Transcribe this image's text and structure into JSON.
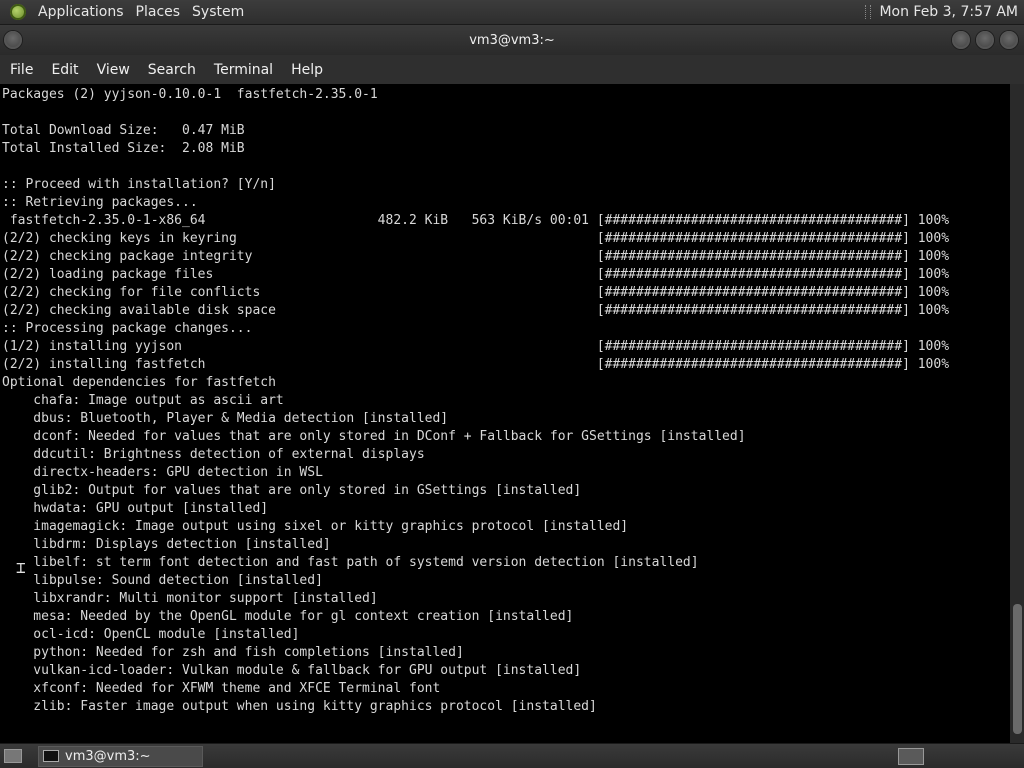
{
  "top_panel": {
    "menus": [
      "Applications",
      "Places",
      "System"
    ],
    "clock": "Mon Feb  3,  7:57 AM"
  },
  "window": {
    "title": "vm3@vm3:~"
  },
  "menubar": {
    "items": [
      "File",
      "Edit",
      "View",
      "Search",
      "Terminal",
      "Help"
    ]
  },
  "terminal": {
    "lines": [
      "Packages (2) yyjson-0.10.0-1  fastfetch-2.35.0-1",
      "",
      "Total Download Size:   0.47 MiB",
      "Total Installed Size:  2.08 MiB",
      "",
      ":: Proceed with installation? [Y/n]",
      ":: Retrieving packages...",
      " fastfetch-2.35.0-1-x86_64                      482.2 KiB   563 KiB/s 00:01 [######################################] 100%",
      "(2/2) checking keys in keyring                                              [######################################] 100%",
      "(2/2) checking package integrity                                            [######################################] 100%",
      "(2/2) loading package files                                                 [######################################] 100%",
      "(2/2) checking for file conflicts                                           [######################################] 100%",
      "(2/2) checking available disk space                                         [######################################] 100%",
      ":: Processing package changes...",
      "(1/2) installing yyjson                                                     [######################################] 100%",
      "(2/2) installing fastfetch                                                  [######################################] 100%",
      "Optional dependencies for fastfetch",
      "    chafa: Image output as ascii art",
      "    dbus: Bluetooth, Player & Media detection [installed]",
      "    dconf: Needed for values that are only stored in DConf + Fallback for GSettings [installed]",
      "    ddcutil: Brightness detection of external displays",
      "    directx-headers: GPU detection in WSL",
      "    glib2: Output for values that are only stored in GSettings [installed]",
      "    hwdata: GPU output [installed]",
      "    imagemagick: Image output using sixel or kitty graphics protocol [installed]",
      "    libdrm: Displays detection [installed]",
      "    libelf: st term font detection and fast path of systemd version detection [installed]",
      "    libpulse: Sound detection [installed]",
      "    libxrandr: Multi monitor support [installed]",
      "    mesa: Needed by the OpenGL module for gl context creation [installed]",
      "    ocl-icd: OpenCL module [installed]",
      "    python: Needed for zsh and fish completions [installed]",
      "    vulkan-icd-loader: Vulkan module & fallback for GPU output [installed]",
      "    xfconf: Needed for XFWM theme and XFCE Terminal font",
      "    zlib: Faster image output when using kitty graphics protocol [installed]"
    ]
  },
  "taskbar": {
    "task_label": "vm3@vm3:~"
  }
}
